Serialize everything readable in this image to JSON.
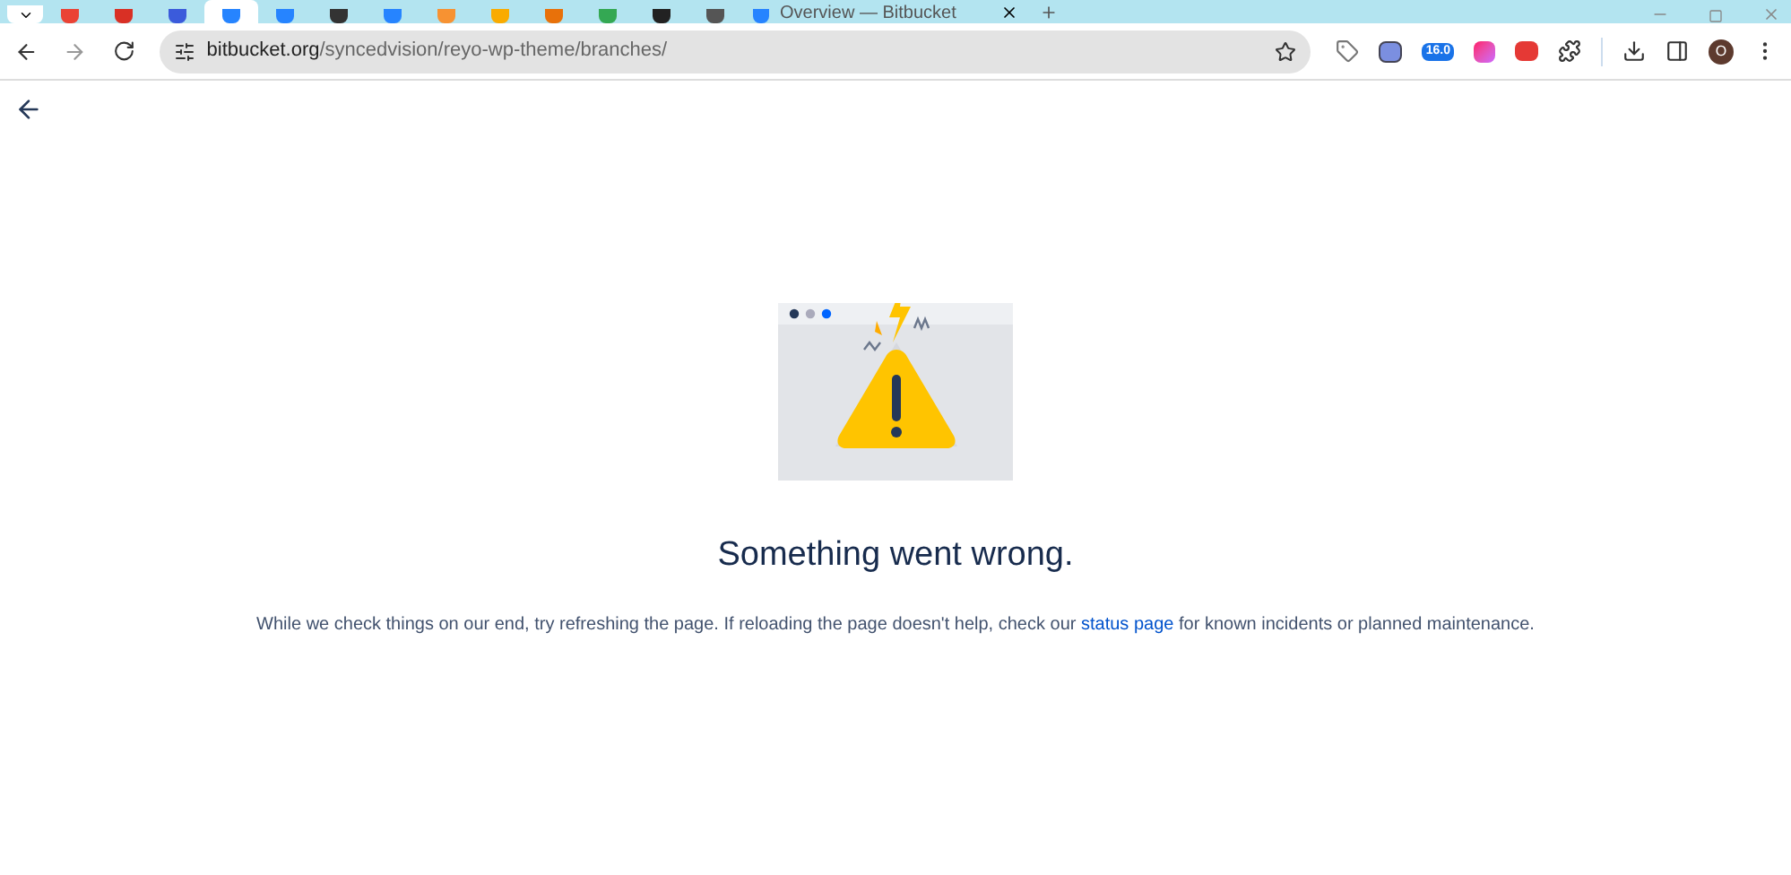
{
  "tabs": [
    {
      "kind": "favicon",
      "color": "#ea4335",
      "selected": false
    },
    {
      "kind": "favicon",
      "color": "#d93025",
      "selected": false
    },
    {
      "kind": "favicon",
      "color": "#3b5bdb",
      "selected": false
    },
    {
      "kind": "favicon",
      "color": "#2684ff",
      "selected": true
    },
    {
      "kind": "favicon",
      "color": "#2684ff",
      "selected": false
    },
    {
      "kind": "favicon",
      "color": "#333333",
      "selected": false
    },
    {
      "kind": "favicon",
      "color": "#2684ff",
      "selected": false
    },
    {
      "kind": "favicon",
      "color": "#f79232",
      "selected": false
    },
    {
      "kind": "favicon",
      "color": "#f9ab00",
      "selected": false
    },
    {
      "kind": "favicon",
      "color": "#e8710a",
      "selected": false
    },
    {
      "kind": "favicon",
      "color": "#34a853",
      "selected": false
    },
    {
      "kind": "favicon",
      "color": "#222222",
      "selected": false
    },
    {
      "kind": "favicon",
      "color": "#555555",
      "selected": false
    },
    {
      "kind": "titled",
      "color": "#2684ff",
      "title": "Overview — Bitbucket",
      "selected": false
    }
  ],
  "address_bar": {
    "domain": "bitbucket.org",
    "path": "/syncedvision/reyo-wp-theme/branches/"
  },
  "extension_badge": "16.0",
  "profile_initial": "O",
  "error": {
    "heading": "Something went wrong.",
    "message_before": "While we check things on our end, try refreshing the page. If reloading the page doesn't help, check our ",
    "link": "status page",
    "message_after": " for known incidents or planned maintenance."
  }
}
